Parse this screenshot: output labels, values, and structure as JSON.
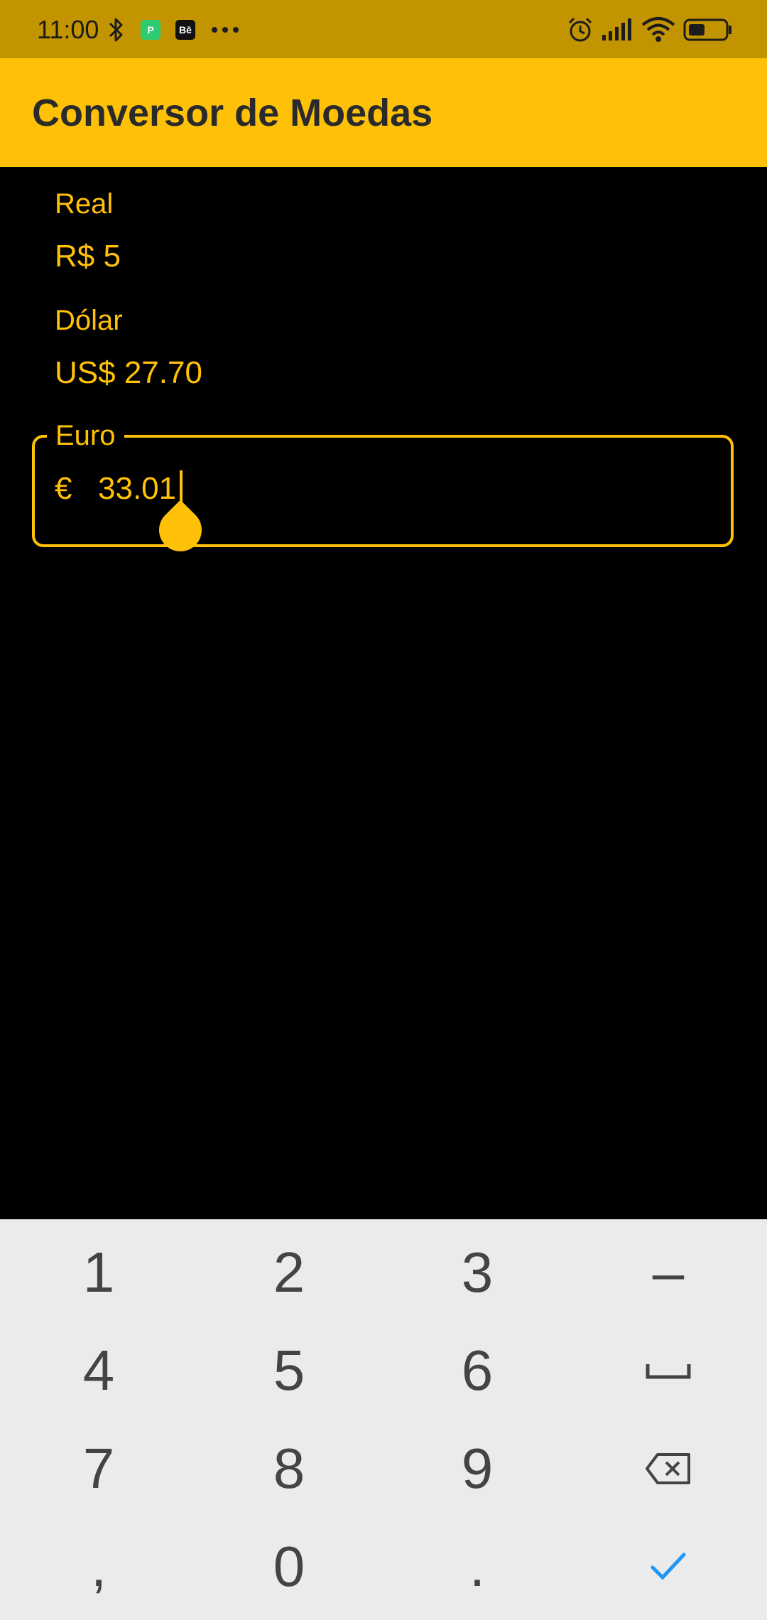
{
  "status_bar": {
    "time": "11:00",
    "icons": [
      "bluetooth-icon",
      "pix-app-icon",
      "behance-app-icon",
      "more-dots-icon",
      "alarm-icon",
      "signal-icon",
      "wifi-icon",
      "battery-icon"
    ],
    "pix_badge": "P",
    "behance_badge": "Bē"
  },
  "app_bar": {
    "title": "Conversor de Moedas",
    "color": "#FFC107"
  },
  "fields": {
    "real": {
      "label": "Real",
      "value": "R$ 5"
    },
    "dolar": {
      "label": "Dólar",
      "value": "US$ 27.70"
    },
    "euro": {
      "label": "Euro",
      "prefix": "€",
      "value": "33.01"
    }
  },
  "keyboard": {
    "rows": [
      [
        "1",
        "2",
        "3",
        "–"
      ],
      [
        "4",
        "5",
        "6",
        "space"
      ],
      [
        "7",
        "8",
        "9",
        "backspace"
      ],
      [
        ",",
        "0",
        ".",
        "done"
      ]
    ],
    "accent_color": "#2196F3"
  }
}
